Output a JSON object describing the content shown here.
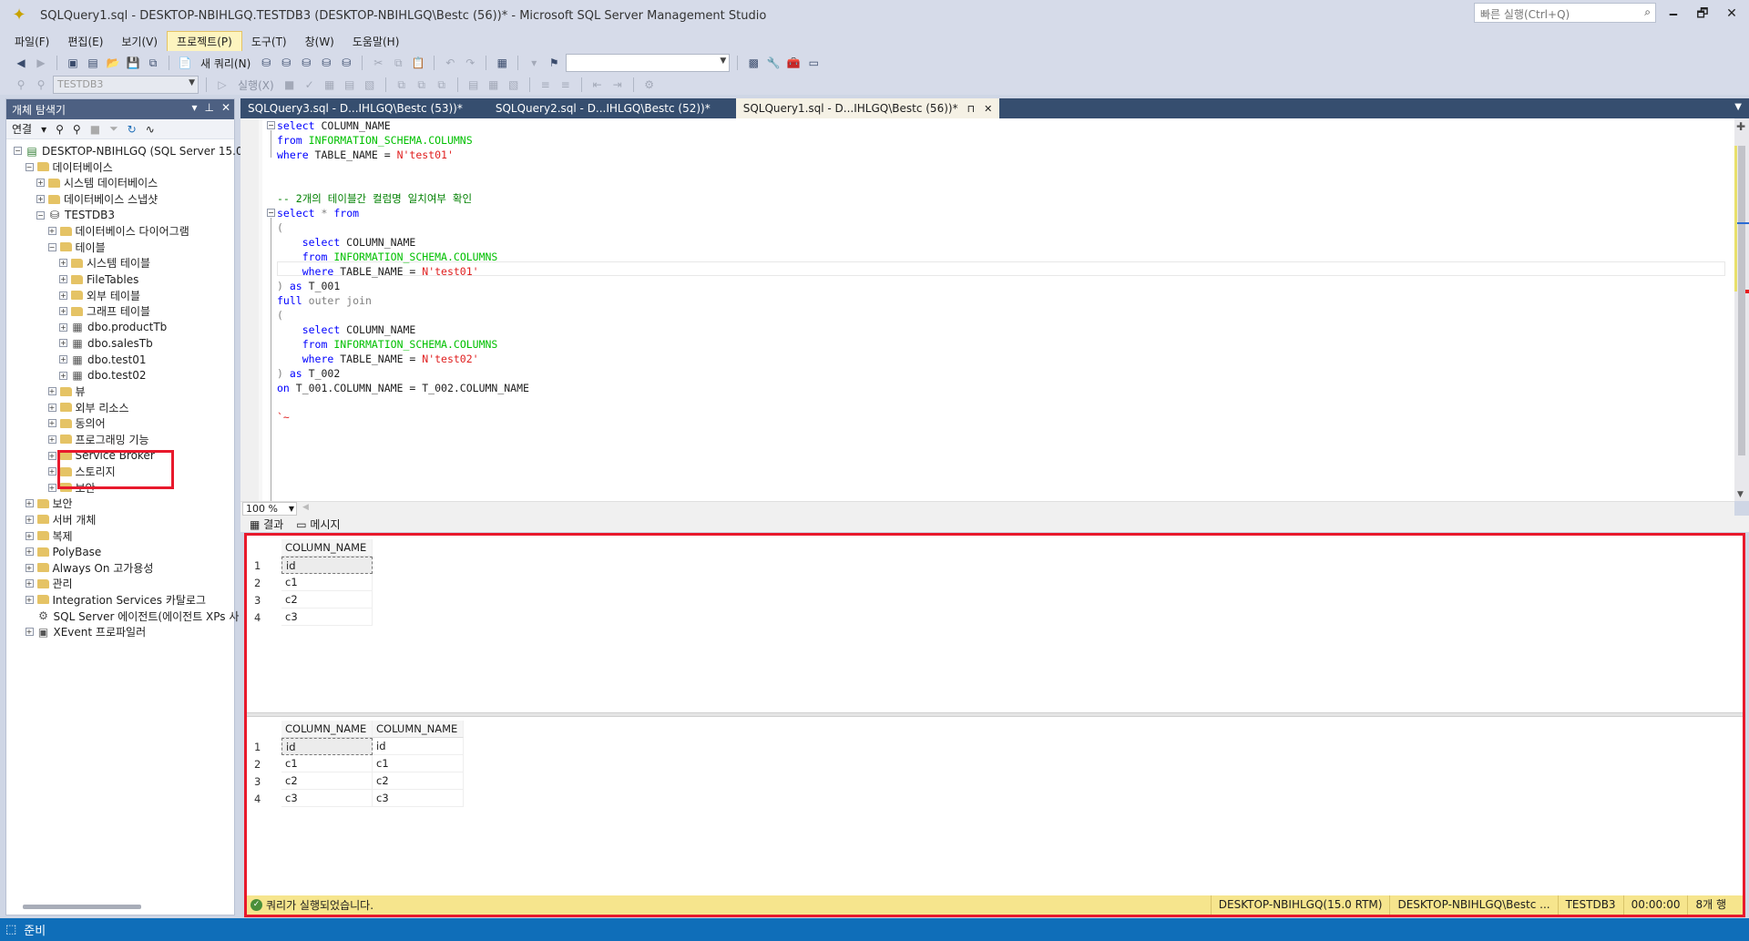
{
  "window": {
    "title": "SQLQuery1.sql - DESKTOP-NBIHLGQ.TESTDB3 (DESKTOP-NBIHLGQ\\Bestc (56))* - Microsoft SQL Server Management Studio",
    "quick_launch_placeholder": "빠른 실행(Ctrl+Q)",
    "minimize": "🗕",
    "restore": "🗗",
    "close": "✕"
  },
  "menu": [
    "파일(F)",
    "편집(E)",
    "보기(V)",
    "프로젝트(P)",
    "도구(T)",
    "창(W)",
    "도움말(H)"
  ],
  "toolbar": {
    "new_query": "새 쿼리(N)",
    "db_selector": "TESTDB3",
    "execute": "실행(X)"
  },
  "object_explorer": {
    "title": "개체 탐색기",
    "connect": "연결",
    "tree": [
      {
        "level": 0,
        "exp": "−",
        "icon": "server",
        "label": "DESKTOP-NBIHLGQ (SQL Server 15.0.2000"
      },
      {
        "level": 1,
        "exp": "−",
        "icon": "folder",
        "label": "데이터베이스"
      },
      {
        "level": 2,
        "exp": "+",
        "icon": "folder",
        "label": "시스템 데이터베이스"
      },
      {
        "level": 2,
        "exp": "+",
        "icon": "folder",
        "label": "데이터베이스 스냅샷"
      },
      {
        "level": 2,
        "exp": "−",
        "icon": "database",
        "label": "TESTDB3"
      },
      {
        "level": 3,
        "exp": "+",
        "icon": "folder",
        "label": "데이터베이스 다이어그램"
      },
      {
        "level": 3,
        "exp": "−",
        "icon": "folder",
        "label": "테이블"
      },
      {
        "level": 4,
        "exp": "+",
        "icon": "folder",
        "label": "시스템 테이블"
      },
      {
        "level": 4,
        "exp": "+",
        "icon": "folder",
        "label": "FileTables"
      },
      {
        "level": 4,
        "exp": "+",
        "icon": "folder",
        "label": "외부 테이블"
      },
      {
        "level": 4,
        "exp": "+",
        "icon": "folder",
        "label": "그래프 테이블"
      },
      {
        "level": 4,
        "exp": "+",
        "icon": "table",
        "label": "dbo.productTb"
      },
      {
        "level": 4,
        "exp": "+",
        "icon": "table",
        "label": "dbo.salesTb"
      },
      {
        "level": 4,
        "exp": "+",
        "icon": "table",
        "label": "dbo.test01"
      },
      {
        "level": 4,
        "exp": "+",
        "icon": "table",
        "label": "dbo.test02"
      },
      {
        "level": 3,
        "exp": "+",
        "icon": "folder",
        "label": "뷰"
      },
      {
        "level": 3,
        "exp": "+",
        "icon": "folder",
        "label": "외부 리소스"
      },
      {
        "level": 3,
        "exp": "+",
        "icon": "folder",
        "label": "동의어"
      },
      {
        "level": 3,
        "exp": "+",
        "icon": "folder",
        "label": "프로그래밍 기능"
      },
      {
        "level": 3,
        "exp": "+",
        "icon": "folder",
        "label": "Service Broker"
      },
      {
        "level": 3,
        "exp": "+",
        "icon": "folder",
        "label": "스토리지"
      },
      {
        "level": 3,
        "exp": "+",
        "icon": "folder",
        "label": "보안"
      },
      {
        "level": 1,
        "exp": "+",
        "icon": "folder",
        "label": "보안"
      },
      {
        "level": 1,
        "exp": "+",
        "icon": "folder",
        "label": "서버 개체"
      },
      {
        "level": 1,
        "exp": "+",
        "icon": "folder",
        "label": "복제"
      },
      {
        "level": 1,
        "exp": "+",
        "icon": "folder",
        "label": "PolyBase"
      },
      {
        "level": 1,
        "exp": "+",
        "icon": "folder",
        "label": "Always On 고가용성"
      },
      {
        "level": 1,
        "exp": "+",
        "icon": "folder",
        "label": "관리"
      },
      {
        "level": 1,
        "exp": "+",
        "icon": "folder",
        "label": "Integration Services 카탈로그"
      },
      {
        "level": 1,
        "exp": "",
        "icon": "agent",
        "label": "SQL Server 에이전트(에이전트 XPs 사"
      },
      {
        "level": 1,
        "exp": "+",
        "icon": "xevent",
        "label": "XEvent 프로파일러"
      }
    ]
  },
  "tabs": [
    {
      "label": "SQLQuery3.sql - D...IHLGQ\\Bestc (53))*",
      "active": false
    },
    {
      "label": "SQLQuery2.sql - D...IHLGQ\\Bestc (52))*",
      "active": false
    },
    {
      "label": "SQLQuery1.sql - D...IHLGQ\\Bestc (56))*",
      "active": true
    }
  ],
  "code": [
    [
      {
        "t": "kw",
        "v": "select"
      },
      {
        "t": "",
        "v": " COLUMN_NAME"
      }
    ],
    [
      {
        "t": "kw",
        "v": "from"
      },
      {
        "t": "",
        "v": " "
      },
      {
        "t": "sys",
        "v": "INFORMATION_SCHEMA.COLUMNS"
      }
    ],
    [
      {
        "t": "kw",
        "v": "where"
      },
      {
        "t": "",
        "v": " TABLE_NAME = "
      },
      {
        "t": "str",
        "v": "N'test01'"
      }
    ],
    [],
    [],
    [
      {
        "t": "cm",
        "v": "-- 2개의 테이블간 컬럼명 일치여부 확인"
      }
    ],
    [
      {
        "t": "kw",
        "v": "select"
      },
      {
        "t": "",
        "v": " "
      },
      {
        "t": "gray",
        "v": "*"
      },
      {
        "t": "",
        "v": " "
      },
      {
        "t": "kw",
        "v": "from"
      }
    ],
    [
      {
        "t": "gray",
        "v": "("
      }
    ],
    [
      {
        "t": "",
        "v": "    "
      },
      {
        "t": "kw",
        "v": "select"
      },
      {
        "t": "",
        "v": " COLUMN_NAME"
      }
    ],
    [
      {
        "t": "",
        "v": "    "
      },
      {
        "t": "kw",
        "v": "from"
      },
      {
        "t": "",
        "v": " "
      },
      {
        "t": "sys",
        "v": "INFORMATION_SCHEMA.COLUMNS"
      }
    ],
    [
      {
        "t": "",
        "v": "    "
      },
      {
        "t": "kw",
        "v": "where"
      },
      {
        "t": "",
        "v": " TABLE_NAME = "
      },
      {
        "t": "str",
        "v": "N'test01'"
      }
    ],
    [
      {
        "t": "gray",
        "v": ")"
      },
      {
        "t": "",
        "v": " "
      },
      {
        "t": "kw",
        "v": "as"
      },
      {
        "t": "",
        "v": " T_001"
      }
    ],
    [
      {
        "t": "kw",
        "v": "full"
      },
      {
        "t": "",
        "v": " "
      },
      {
        "t": "gray",
        "v": "outer join"
      }
    ],
    [
      {
        "t": "gray",
        "v": "("
      }
    ],
    [
      {
        "t": "",
        "v": "    "
      },
      {
        "t": "kw",
        "v": "select"
      },
      {
        "t": "",
        "v": " COLUMN_NAME"
      }
    ],
    [
      {
        "t": "",
        "v": "    "
      },
      {
        "t": "kw",
        "v": "from"
      },
      {
        "t": "",
        "v": " "
      },
      {
        "t": "sys",
        "v": "INFORMATION_SCHEMA.COLUMNS"
      }
    ],
    [
      {
        "t": "",
        "v": "    "
      },
      {
        "t": "kw",
        "v": "where"
      },
      {
        "t": "",
        "v": " TABLE_NAME = "
      },
      {
        "t": "str",
        "v": "N'test02'"
      }
    ],
    [
      {
        "t": "gray",
        "v": ")"
      },
      {
        "t": "",
        "v": " "
      },
      {
        "t": "kw",
        "v": "as"
      },
      {
        "t": "",
        "v": " T_002"
      }
    ],
    [
      {
        "t": "kw",
        "v": "on"
      },
      {
        "t": "",
        "v": " T_001.COLUMN_NAME = T_002.COLUMN_NAME"
      }
    ],
    [],
    [
      {
        "t": "str",
        "v": "`~"
      }
    ]
  ],
  "zoom": "100 %",
  "results_tabs": {
    "results": "결과",
    "messages": "메시지"
  },
  "grid1": {
    "columns": [
      "COLUMN_NAME"
    ],
    "rows": [
      [
        "id"
      ],
      [
        "c1"
      ],
      [
        "c2"
      ],
      [
        "c3"
      ]
    ]
  },
  "grid2": {
    "columns": [
      "COLUMN_NAME",
      "COLUMN_NAME"
    ],
    "rows": [
      [
        "id",
        "id"
      ],
      [
        "c1",
        "c1"
      ],
      [
        "c2",
        "c2"
      ],
      [
        "c3",
        "c3"
      ]
    ]
  },
  "query_status": {
    "message": "쿼리가 실행되었습니다.",
    "server": "DESKTOP-NBIHLGQ(15.0 RTM)",
    "user": "DESKTOP-NBIHLGQ\\Bestc ...",
    "database": "TESTDB3",
    "elapsed": "00:00:00",
    "rows": "8개 행"
  },
  "status": {
    "text": "준비"
  }
}
